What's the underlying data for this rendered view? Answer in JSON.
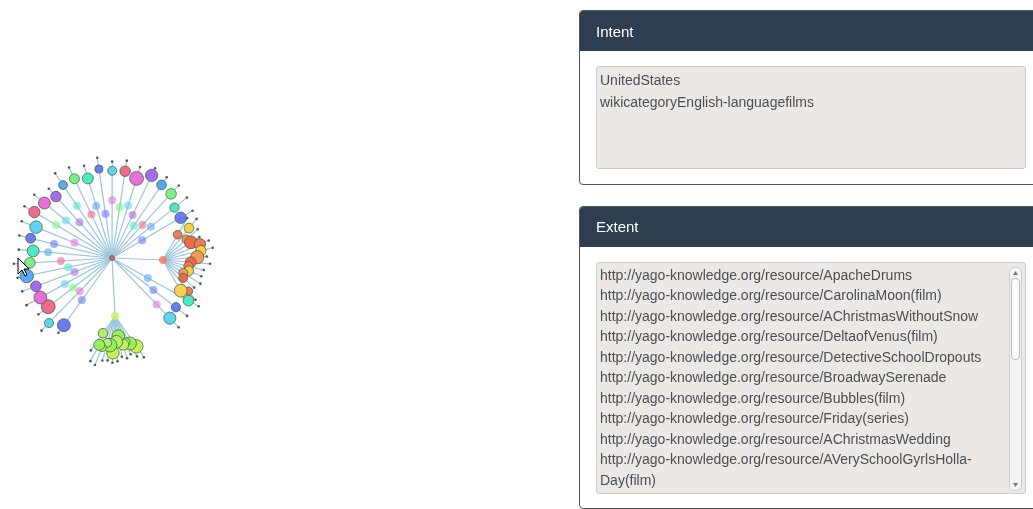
{
  "panels": [
    {
      "title": "Intent",
      "kind": "textarea",
      "lines": [
        "UnitedStates",
        "wikicategoryEnglish-languagefilms"
      ]
    },
    {
      "title": "Extent",
      "kind": "list",
      "lines": [
        "http://yago-knowledge.org/resource/ApacheDrums",
        "http://yago-knowledge.org/resource/CarolinaMoon(film)",
        "http://yago-knowledge.org/resource/AChristmasWithoutSnow",
        "http://yago-knowledge.org/resource/DeltaofVenus(film)",
        "http://yago-knowledge.org/resource/DetectiveSchoolDropouts",
        "http://yago-knowledge.org/resource/BroadwaySerenade",
        "http://yago-knowledge.org/resource/Bubbles(film)",
        "http://yago-knowledge.org/resource/Friday(series)",
        "http://yago-knowledge.org/resource/AChristmasWedding",
        "http://yago-knowledge.org/resource/AVerySchoolGyrlsHolla-Day(film)"
      ]
    }
  ]
}
